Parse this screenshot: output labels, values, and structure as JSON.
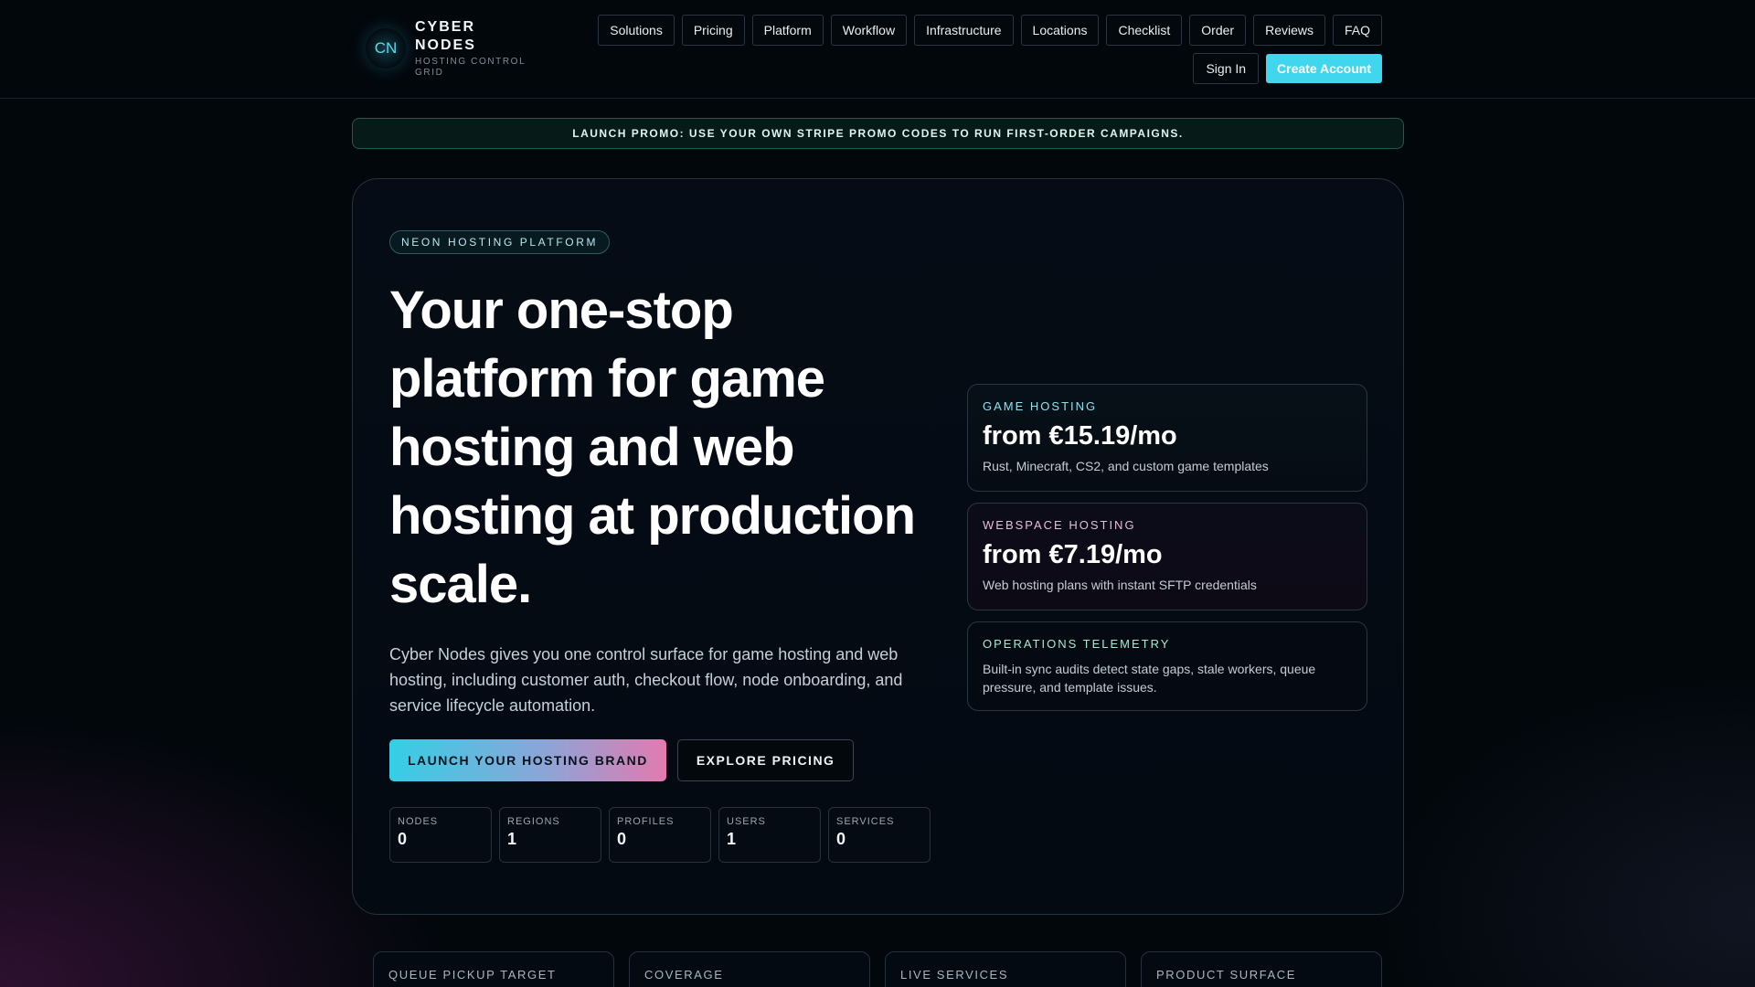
{
  "brand": {
    "logo_text": "CN",
    "name": "CYBER NODES",
    "subtitle": "HOSTING CONTROL GRID"
  },
  "nav": {
    "items": [
      "Solutions",
      "Pricing",
      "Platform",
      "Workflow",
      "Infrastructure",
      "Locations",
      "Checklist",
      "Order",
      "Reviews",
      "FAQ"
    ],
    "sign_in": "Sign In",
    "create_account": "Create Account"
  },
  "promo": {
    "text": "LAUNCH PROMO: USE YOUR OWN STRIPE PROMO CODES TO RUN FIRST-ORDER CAMPAIGNS."
  },
  "hero": {
    "badge": "NEON HOSTING PLATFORM",
    "headline": "Your one-stop platform for game hosting and web hosting at production scale.",
    "lead": "Cyber Nodes gives you one control surface for game hosting and web hosting, including customer auth, checkout flow, node onboarding, and service lifecycle automation.",
    "cta_primary": "LAUNCH YOUR HOSTING BRAND",
    "cta_secondary": "EXPLORE PRICING",
    "stats": [
      {
        "label": "NODES",
        "value": "0"
      },
      {
        "label": "REGIONS",
        "value": "1"
      },
      {
        "label": "PROFILES",
        "value": "0"
      },
      {
        "label": "USERS",
        "value": "1"
      },
      {
        "label": "SERVICES",
        "value": "0"
      }
    ]
  },
  "offers": {
    "game": {
      "kicker": "GAME HOSTING",
      "price": "from €15.19/mo",
      "desc": "Rust, Minecraft, CS2, and custom game templates"
    },
    "web": {
      "kicker": "WEBSPACE HOSTING",
      "price": "from €7.19/mo",
      "desc": "Web hosting plans with instant SFTP credentials"
    },
    "ops": {
      "kicker": "OPERATIONS TELEMETRY",
      "desc": "Built-in sync audits detect state gaps, stale workers, queue pressure, and template issues."
    }
  },
  "bottom_cards": [
    "QUEUE PICKUP TARGET",
    "COVERAGE",
    "LIVE SERVICES",
    "PRODUCT SURFACE"
  ],
  "colors": {
    "background": "#02070c",
    "accent_cyan": "#3fd6ee",
    "accent_pink": "#e27ab0",
    "promo_border": "#1e5c4c"
  }
}
